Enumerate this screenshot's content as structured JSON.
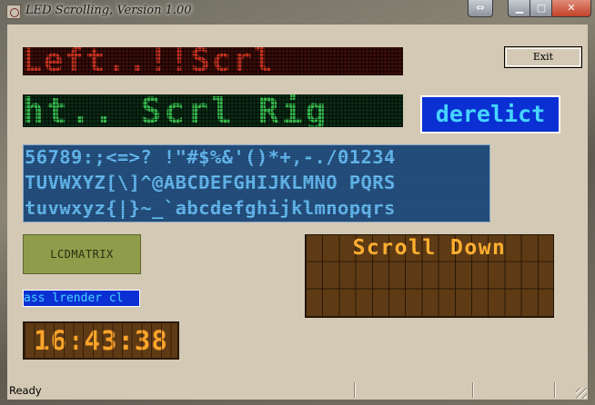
{
  "window": {
    "title": "LED Scrolling, Version 1.00",
    "controls": {
      "restore_icon": "double-arrow-icon",
      "minimize_icon": "minimize-icon",
      "maximize_icon": "maximize-icon",
      "close_icon": "close-icon"
    }
  },
  "buttons": {
    "exit_label": "Exit"
  },
  "displays": {
    "led_left": "Left..!!Scrl",
    "led_right": "ht.. Scrl Rig",
    "derelict": "derelict",
    "charset_lines": [
      "56789:;<=>? !\"#$%&'()*+,-./01234",
      "TUVWXYZ[\\]^@ABCDEFGHIJKLMNO PQRS",
      "tuvwxyz{|}~_`abcdefghijklmnopqrs"
    ],
    "lcdmatrix": "LCDMATRIX",
    "scroll_down": "Scroll Down",
    "classrender": "ass lrender cl",
    "clock": "16:43:38"
  },
  "colors": {
    "led_red": "#c4301f",
    "led_green": "#35b64c",
    "blue_panel": "#0a2fd3",
    "cyan_text": "#46d5ff",
    "amber_text": "#ffae30",
    "lcd_olive": "#8f9c4a",
    "dialog_bg": "#d4c9b5"
  },
  "status": {
    "text": "Ready"
  }
}
